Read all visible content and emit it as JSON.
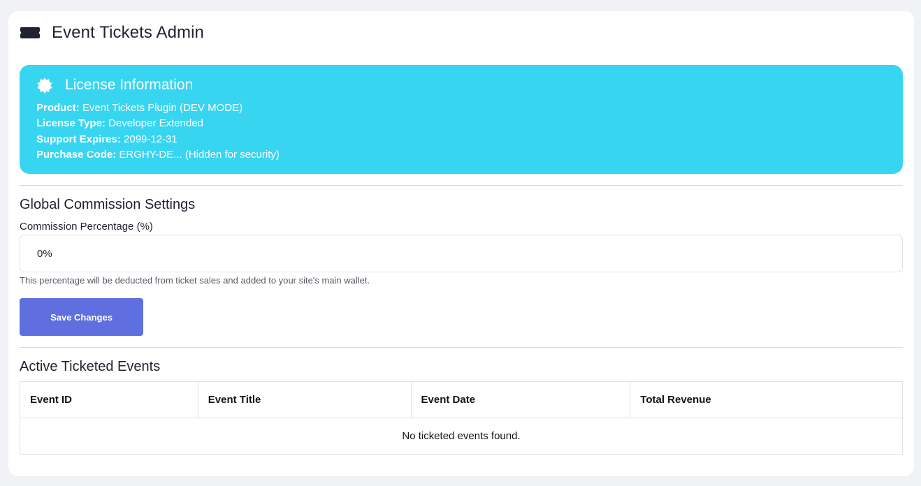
{
  "header": {
    "title": "Event Tickets Admin",
    "icon": "ticket-icon"
  },
  "license": {
    "title": "License Information",
    "icon": "certificate-icon",
    "background_color": "#38d5f1",
    "lines": [
      {
        "label": "Product:",
        "value": "Event Tickets Plugin (DEV MODE)"
      },
      {
        "label": "License Type:",
        "value": "Developer Extended"
      },
      {
        "label": "Support Expires:",
        "value": "2099-12-31"
      },
      {
        "label": "Purchase Code:",
        "value": "ERGHY-DE... (Hidden for security)"
      }
    ]
  },
  "commission": {
    "section_title": "Global Commission Settings",
    "field_label": "Commission Percentage (%)",
    "value": "0%",
    "help_text": "This percentage will be deducted from ticket sales and added to your site's main wallet.",
    "save_label": "Save Changes",
    "button_color": "#5f6fe0"
  },
  "events": {
    "section_title": "Active Ticketed Events",
    "columns": [
      "Event ID",
      "Event Title",
      "Event Date",
      "Total Revenue"
    ],
    "empty_message": "No ticketed events found."
  }
}
